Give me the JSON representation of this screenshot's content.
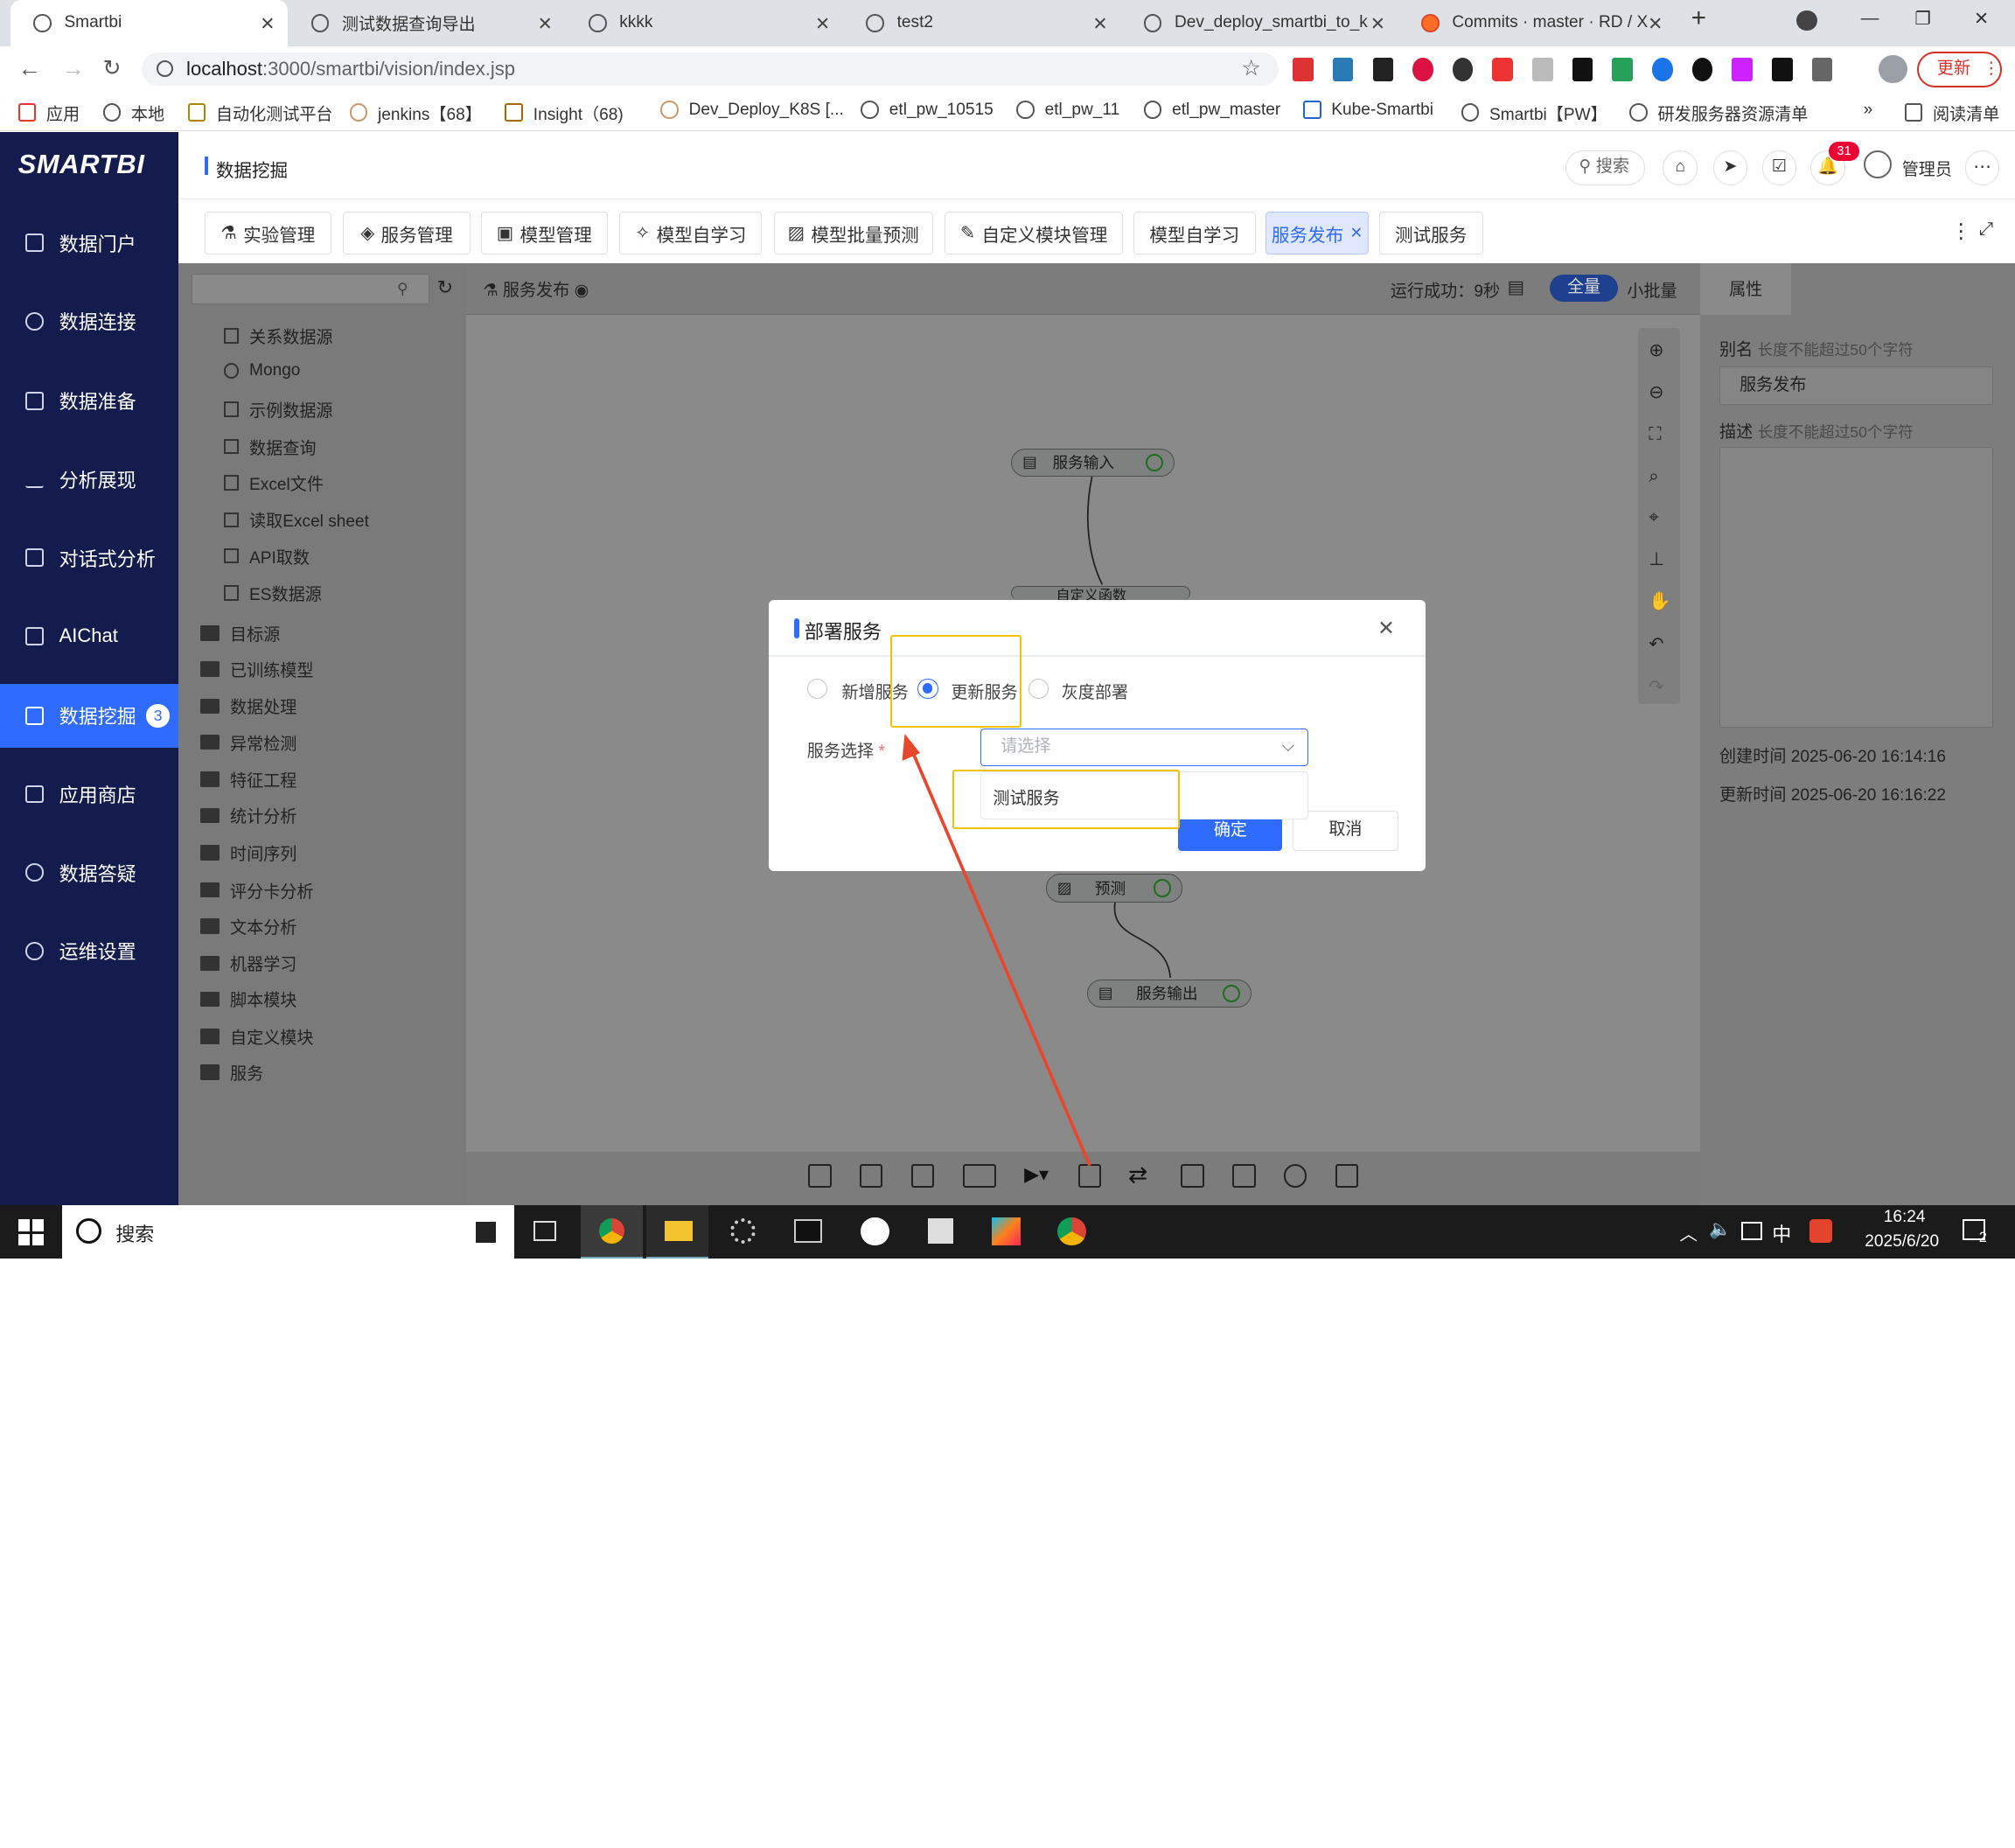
{
  "browser": {
    "tabs": [
      {
        "title": "Smartbi"
      },
      {
        "title": "测试数据查询导出"
      },
      {
        "title": "kkkk"
      },
      {
        "title": "test2"
      },
      {
        "title": "Dev_deploy_smartbi_to_k"
      },
      {
        "title": "Commits · master · RD / X"
      }
    ],
    "url_host": "localhost",
    "url_rest": ":3000/smartbi/vision/index.jsp",
    "update_label": "更新",
    "bookmarks": [
      "应用",
      "本地",
      "自动化测试平台",
      "jenkins【68】",
      "Insight（68)",
      "Dev_Deploy_K8S [...",
      "etl_pw_10515",
      "etl_pw_11",
      "etl_pw_master",
      "Kube-Smartbi",
      "Smartbi【PW】",
      "研发服务器资源清单"
    ],
    "reading_list": "阅读清单",
    "more": "»"
  },
  "app": {
    "logo": "SMARTBI",
    "section_title": "数据挖掘",
    "search_label": "搜索",
    "notif_count": "31",
    "user": "管理员"
  },
  "sidebar": {
    "items": [
      {
        "label": "数据门户"
      },
      {
        "label": "数据连接"
      },
      {
        "label": "数据准备"
      },
      {
        "label": "分析展现"
      },
      {
        "label": "对话式分析"
      },
      {
        "label": "AIChat"
      },
      {
        "label": "数据挖掘",
        "badge": "3"
      },
      {
        "label": "应用商店"
      },
      {
        "label": "数据答疑"
      },
      {
        "label": "运维设置"
      }
    ]
  },
  "toolbar_tabs": [
    "实验管理",
    "服务管理",
    "模型管理",
    "模型自学习",
    "模型批量预测",
    "自定义模块管理",
    "模型自学习",
    "服务发布",
    "测试服务"
  ],
  "tree": {
    "items": [
      "关系数据源",
      "Mongo",
      "示例数据源",
      "数据查询",
      "Excel文件",
      "读取Excel sheet",
      "API取数",
      "ES数据源"
    ],
    "folders": [
      "目标源",
      "已训练模型",
      "数据处理",
      "异常检测",
      "特征工程",
      "统计分析",
      "时间序列",
      "评分卡分析",
      "文本分析",
      "机器学习",
      "脚本模块",
      "自定义模块",
      "服务"
    ]
  },
  "canvas": {
    "title": "服务发布",
    "run_status": "运行成功：9秒",
    "full": "全量",
    "small": "小批量",
    "nodes": [
      "服务输入",
      "自定义函数",
      "预测",
      "服务输出"
    ]
  },
  "props": {
    "tab": "属性",
    "alias_label": "别名",
    "alias_hint": "长度不能超过50个字符",
    "alias_value": "服务发布",
    "desc_label": "描述",
    "desc_hint": "长度不能超过50个字符",
    "created": "创建时间 2025-06-20 16:14:16",
    "updated": "更新时间 2025-06-20 16:16:22"
  },
  "dialog": {
    "title": "部署服务",
    "radios": [
      "新增服务",
      "更新服务",
      "灰度部署"
    ],
    "selected": "更新服务",
    "field_label": "服务选择",
    "required": "*",
    "placeholder": "请选择",
    "option": "测试服务",
    "confirm": "确定",
    "cancel": "取消"
  },
  "taskbar": {
    "search": "搜索",
    "time": "16:24",
    "date": "2025/6/20",
    "ime": "中",
    "notif": "2"
  },
  "colors": {
    "accent": "#2f6bff",
    "sidebar": "#141b4d",
    "highlight": "#f2c200",
    "arrow": "#e8472b"
  }
}
